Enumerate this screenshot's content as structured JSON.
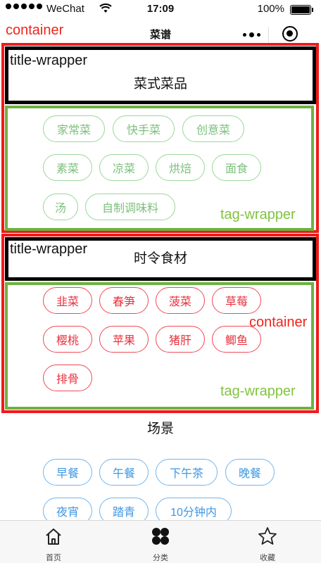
{
  "status_bar": {
    "carrier": "WeChat",
    "time": "17:09",
    "battery": "100%"
  },
  "nav": {
    "title": "菜谱"
  },
  "annotations": {
    "container_top": "container",
    "title_wrapper_1": "title-wrapper",
    "tag_wrapper_1": "tag-wrapper",
    "title_wrapper_2": "title-wrapper",
    "container_2": "container",
    "tag_wrapper_2": "tag-wrapper"
  },
  "sections": [
    {
      "title": "菜式菜品",
      "color": "#7cc07c",
      "tags": [
        "家常菜",
        "快手菜",
        "创意菜",
        "素菜",
        "凉菜",
        "烘焙",
        "面食",
        "汤",
        "自制调味料"
      ]
    },
    {
      "title": "时令食材",
      "color": "#e8323e",
      "tags": [
        "韭菜",
        "春笋",
        "菠菜",
        "草莓",
        "樱桃",
        "苹果",
        "猪肝",
        "鲫鱼",
        "排骨"
      ]
    },
    {
      "title": "场景",
      "color": "#3d97e3",
      "tags": [
        "早餐",
        "午餐",
        "下午茶",
        "晚餐",
        "夜宵",
        "踏青",
        "10分钟内"
      ]
    }
  ],
  "tabbar": [
    {
      "label": "首页",
      "icon": "home-icon"
    },
    {
      "label": "分类",
      "icon": "category-grid-icon"
    },
    {
      "label": "收藏",
      "icon": "star-icon"
    }
  ]
}
